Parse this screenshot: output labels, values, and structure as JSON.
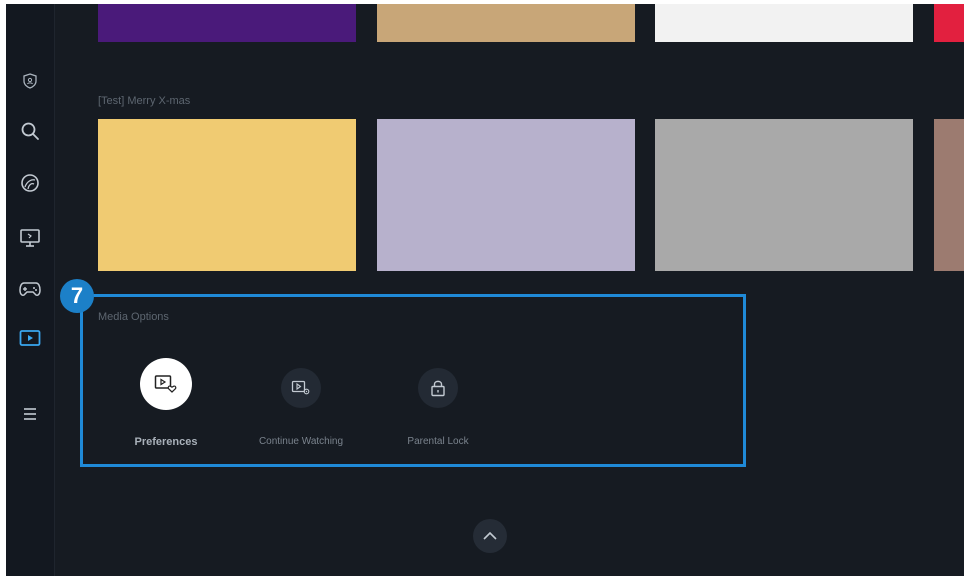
{
  "sidebar": {
    "items": [
      {
        "icon": "shield-profile-icon"
      },
      {
        "icon": "search-icon"
      },
      {
        "icon": "ambient-icon"
      },
      {
        "icon": "live-tv-icon"
      },
      {
        "icon": "gamepad-icon"
      },
      {
        "icon": "media-icon",
        "active": true
      },
      {
        "icon": "menu-icon"
      }
    ]
  },
  "top_row": {
    "tile_colors": [
      "#4a1a7a",
      "#c8a678",
      "#f2f2f2",
      "#e2203f"
    ]
  },
  "merry_xmas_row": {
    "title": "[Test] Merry X-mas",
    "tile_colors": [
      "#f0cb72",
      "#b7b1cc",
      "#a9a9a9",
      "#9c7b70"
    ]
  },
  "callout": {
    "number": "7",
    "color": "#1f8ad8"
  },
  "media_options": {
    "title": "Media Options",
    "options": [
      {
        "label": "Preferences",
        "icon": "preferences-icon",
        "focused": true
      },
      {
        "label": "Continue Watching",
        "icon": "continue-watching-icon",
        "focused": false
      },
      {
        "label": "Parental Lock",
        "icon": "parental-lock-icon",
        "focused": false
      }
    ]
  },
  "scroll_up": {
    "icon": "chevron-up-icon"
  }
}
